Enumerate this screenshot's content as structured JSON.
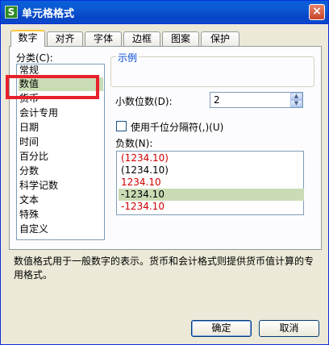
{
  "window": {
    "title": "单元格格式",
    "app_icon": "S",
    "close_glyph": "×"
  },
  "tabs": [
    "数字",
    "对齐",
    "字体",
    "边框",
    "图案",
    "保护"
  ],
  "active_tab": 0,
  "category": {
    "label": "分类(C):",
    "items": [
      "常规",
      "数值",
      "货币",
      "会计专用",
      "日期",
      "时间",
      "百分比",
      "分数",
      "科学记数",
      "文本",
      "特殊",
      "自定义"
    ],
    "selected": "数值"
  },
  "sample": {
    "title": "示例"
  },
  "decimal": {
    "label": "小数位数(D):",
    "value": "2"
  },
  "thousands": {
    "label": "使用千位分隔符(,)(U)",
    "checked": false
  },
  "negative": {
    "label": "负数(N):",
    "items": [
      {
        "text": "(1234.10)",
        "color": "#d00000"
      },
      {
        "text": "(1234.10)",
        "color": "#000000"
      },
      {
        "text": "1234.10",
        "color": "#d00000"
      },
      {
        "text": "-1234.10",
        "color": "#000000"
      },
      {
        "text": "-1234.10",
        "color": "#d00000"
      }
    ],
    "selected_index": 3
  },
  "description": "数值格式用于一般数字的表示。货币和会计格式则提供货币值计算的专用格式。",
  "buttons": {
    "ok": "确定",
    "cancel": "取消"
  }
}
